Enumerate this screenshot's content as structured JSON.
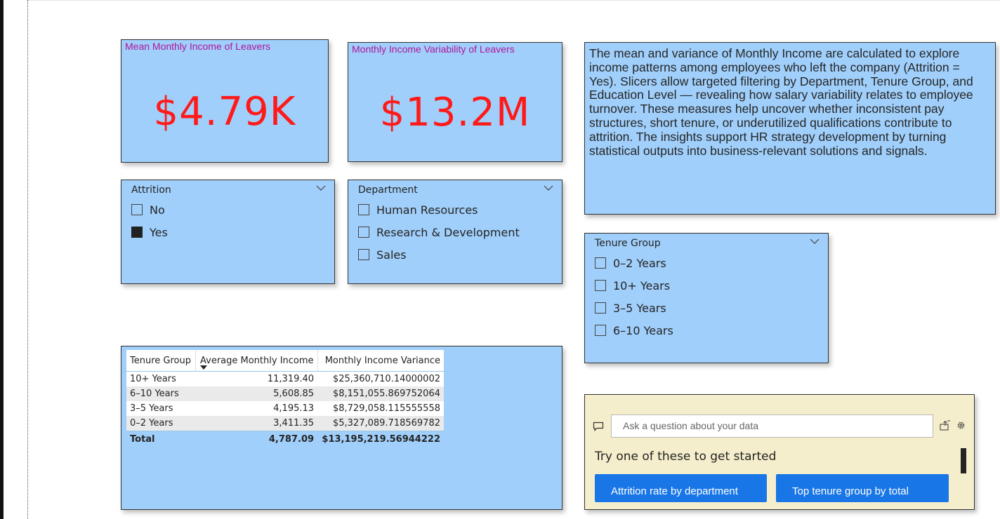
{
  "kpis": [
    {
      "title": "Mean Monthly Income of Leavers",
      "value": "$4.79K"
    },
    {
      "title": "Monthly Income Variability of Leavers",
      "value": "$13.2M"
    }
  ],
  "description": "The mean and variance of Monthly Income are calculated to explore income patterns among employees who left the company (Attrition = Yes). Slicers allow targeted filtering by Department, Tenure Group, and Education Level — revealing how salary variability relates to employee turnover. These measures help uncover whether inconsistent pay structures, short tenure, or underutilized qualifications contribute to attrition. The insights support HR strategy development by turning statistical outputs into business-relevant solutions and signals.",
  "slicers": {
    "attrition": {
      "title": "Attrition",
      "options": [
        {
          "label": "No",
          "checked": false
        },
        {
          "label": "Yes",
          "checked": true
        }
      ]
    },
    "department": {
      "title": "Department",
      "options": [
        {
          "label": "Human Resources",
          "checked": false
        },
        {
          "label": "Research & Development",
          "checked": false
        },
        {
          "label": "Sales",
          "checked": false
        }
      ]
    },
    "tenure": {
      "title": "Tenure Group",
      "options": [
        {
          "label": "0–2 Years",
          "checked": false
        },
        {
          "label": "10+ Years",
          "checked": false
        },
        {
          "label": "3–5 Years",
          "checked": false
        },
        {
          "label": "6–10 Years",
          "checked": false
        }
      ]
    }
  },
  "table": {
    "headers": [
      "Tenure Group",
      "Average Monthly Income",
      "Monthly Income Variance"
    ],
    "rows": [
      [
        "10+ Years",
        "11,319.40",
        "$25,360,710.14000002"
      ],
      [
        "6–10 Years",
        "5,608.85",
        "$8,151,055.869752064"
      ],
      [
        "3–5 Years",
        "4,195.13",
        "$8,729,058.115555558"
      ],
      [
        "0–2 Years",
        "3,411.35",
        "$5,327,089.718569782"
      ]
    ],
    "total": [
      "Total",
      "4,787.09",
      "$13,195,219.56944222"
    ]
  },
  "qa": {
    "placeholder": "Ask a question about your data",
    "prompt": "Try one of these to get started",
    "suggestions": [
      "Attrition rate by department",
      "Top tenure group by total"
    ]
  },
  "colors": {
    "card_bg": "#a0cffb",
    "kpi_value": "#ff1a1a",
    "kpi_title": "#b0169a",
    "qa_bg": "#f5eecc",
    "qa_button": "#1976e6"
  }
}
